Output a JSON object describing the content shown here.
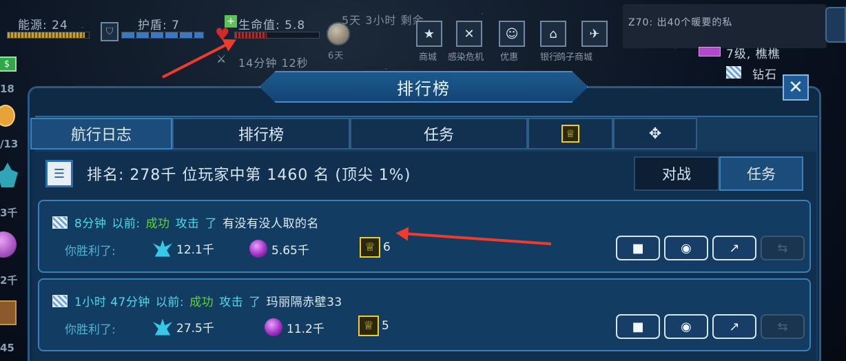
{
  "hud": {
    "energy_label": "能源: 24",
    "energy_level": 0.95,
    "shield_label": "护盾: 7",
    "shield_level": 1.0,
    "hull_label": "生命值: 5.8",
    "hull_level": 0.38,
    "timer_top": "5天 3小时 剩余",
    "timer_bottom": "14分钟 12秒",
    "days_label": "6天",
    "chat_message": "Z70: 出40个暖要的私",
    "player_level": "7级, 樵樵",
    "diamond_label": "钻石",
    "left_numbers": [
      "18",
      "/13",
      "3千",
      "2千",
      "45"
    ]
  },
  "top_buttons": [
    {
      "label": "商城",
      "icon": "star-icon"
    },
    {
      "label": "感染危机",
      "icon": "x-icon"
    },
    {
      "label": "优惠",
      "icon": "face-icon"
    },
    {
      "label": "银行",
      "icon": "bank-icon"
    },
    {
      "label": "鸽子商城",
      "icon": "plane-icon"
    }
  ],
  "dialog": {
    "title": "排行榜",
    "close_glyph": "✕",
    "tabs": [
      {
        "label": "航行日志",
        "active": true
      },
      {
        "label": "排行榜",
        "active": false
      },
      {
        "label": "任务",
        "active": false
      },
      {
        "label": "",
        "icon": "trophy-icon",
        "active": false
      },
      {
        "label": "",
        "icon": "move-icon",
        "active": false
      }
    ],
    "rank_text": "排名: 278千 位玩家中第 1460 名 (顶尖 1%)",
    "segments": [
      {
        "label": "对战",
        "active": false
      },
      {
        "label": "任务",
        "active": true
      }
    ]
  },
  "log_entries": [
    {
      "time": "8分钟",
      "ago": "以前:",
      "result": "成功",
      "action": "攻击",
      "particle": "了",
      "target": "有没有没人取的名",
      "win_label": "你胜利了:",
      "crystals": "12.1千",
      "orbs": "5.65千",
      "trophies": "6"
    },
    {
      "time": "1小时 47分钟",
      "ago": "以前:",
      "result": "成功",
      "action": "攻击",
      "particle": "了",
      "target": "玛丽隔赤壁33",
      "win_label": "你胜利了:",
      "crystals": "27.5千",
      "orbs": "11.2千",
      "trophies": "5"
    }
  ],
  "colors": {
    "accent_cyan": "#4fd8ea",
    "success_green": "#5fd23a",
    "trophy_gold": "#f3cf1c",
    "annotation_red": "#ef3b2e"
  }
}
